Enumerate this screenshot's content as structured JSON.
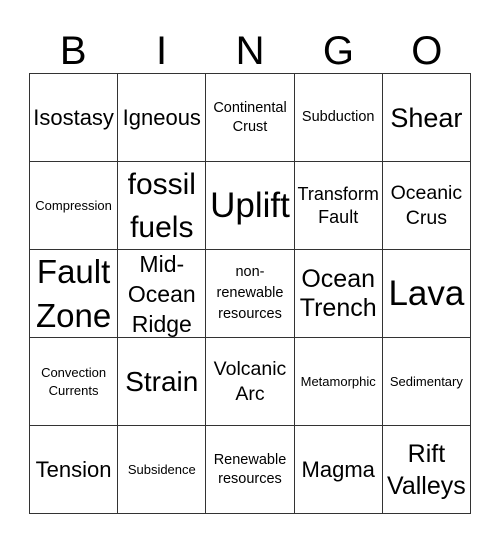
{
  "header": [
    "B",
    "I",
    "N",
    "G",
    "O"
  ],
  "cells": [
    [
      "Isostasy",
      "Igneous",
      "Continental Crust",
      "Subduction",
      "Shear"
    ],
    [
      "Compression",
      "fossil fuels",
      "Uplift",
      "Transform Fault",
      "Oceanic Crus"
    ],
    [
      "Fault Zone",
      "Mid-Ocean Ridge",
      "non-renewable resources",
      "Ocean Trench",
      "Lava"
    ],
    [
      "Convection Currents",
      "Strain",
      "Volcanic Arc",
      "Metamorphic",
      "Sedimentary"
    ],
    [
      "Tension",
      "Subsidence",
      "Renewable resources",
      "Magma",
      "Rift Valleys"
    ]
  ],
  "lines": {
    "c0_2": [
      "Continental",
      "Crust"
    ],
    "c1_1": [
      "fossil",
      "fuels"
    ],
    "c1_3": [
      "Transform",
      "Fault"
    ],
    "c1_4": [
      "Oceanic",
      "Crus"
    ],
    "c2_0": [
      "Fault",
      "Zone"
    ],
    "c2_1": [
      "Mid-",
      "Ocean",
      "Ridge"
    ],
    "c2_2": [
      "non-",
      "renewable",
      "resources"
    ],
    "c2_3": [
      "Ocean",
      "Trench"
    ],
    "c3_0": [
      "Convection",
      "Currents"
    ],
    "c3_2": [
      "Volcanic",
      "Arc"
    ],
    "c4_2": [
      "Renewable",
      "resources"
    ],
    "c4_4": [
      "Rift",
      "Valleys"
    ]
  }
}
